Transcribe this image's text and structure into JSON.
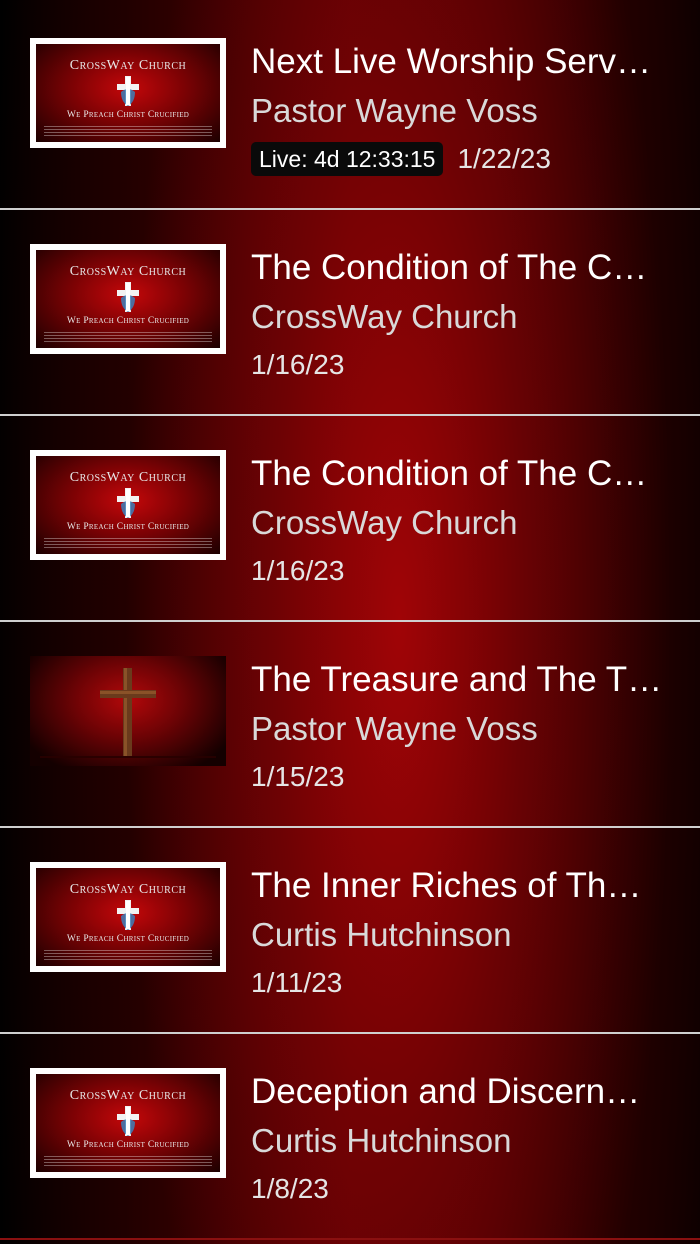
{
  "thumbnail_text": {
    "church_name": "CrossWay Church",
    "tagline": "We Preach Christ Crucified"
  },
  "sermons": [
    {
      "title": "Next Live Worship Serv…",
      "speaker": "Pastor Wayne Voss",
      "live_label": "Live: 4d 12:33:15",
      "date": "1/22/23",
      "thumbnail": "crossway-logo"
    },
    {
      "title": "The Condition of The C…",
      "speaker": "CrossWay Church",
      "date": "1/16/23",
      "thumbnail": "crossway-logo"
    },
    {
      "title": "The Condition of The C…",
      "speaker": "CrossWay Church",
      "date": "1/16/23",
      "thumbnail": "crossway-logo"
    },
    {
      "title": "The Treasure and The T…",
      "speaker": "Pastor Wayne Voss",
      "date": "1/15/23",
      "thumbnail": "wooden-cross"
    },
    {
      "title": "The Inner Riches of Th…",
      "speaker": "Curtis Hutchinson",
      "date": "1/11/23",
      "thumbnail": "crossway-logo"
    },
    {
      "title": "Deception and Discern…",
      "speaker": "Curtis Hutchinson",
      "date": "1/8/23",
      "thumbnail": "crossway-logo"
    }
  ],
  "colors": {
    "background_red": "#8a0004",
    "divider": "#cfcfcf",
    "title_text": "#ffffff",
    "speaker_text": "#d9d9d9",
    "live_badge_bg": "#0a0a0a"
  }
}
